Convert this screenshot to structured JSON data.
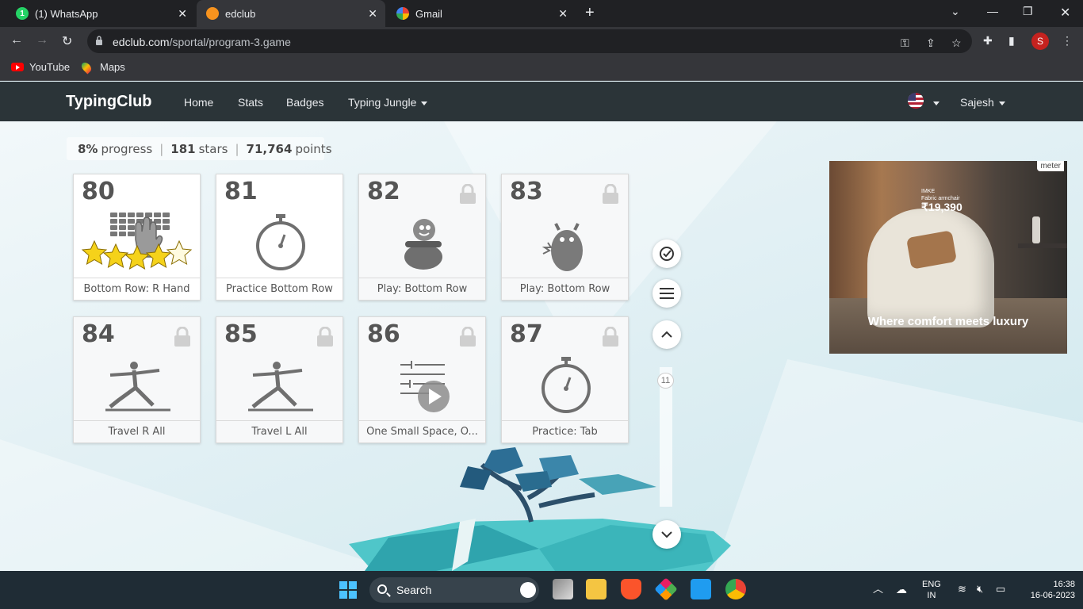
{
  "browser": {
    "tabs": [
      {
        "title": "(1) WhatsApp",
        "badge": "1"
      },
      {
        "title": "edclub"
      },
      {
        "title": "Gmail"
      }
    ],
    "url_domain": "edclub.com",
    "url_path": "/sportal/program-3.game",
    "profile_initial": "S",
    "bookmarks": [
      "YouTube",
      "Maps"
    ]
  },
  "site": {
    "logo": "TypingClub",
    "nav": [
      "Home",
      "Stats",
      "Badges",
      "Typing Jungle"
    ],
    "user": "Sajesh"
  },
  "stats": {
    "progress_value": "8%",
    "progress_label": "progress",
    "stars_value": "181",
    "stars_label": "stars",
    "points_value": "71,764",
    "points_label": "points"
  },
  "lessons": [
    {
      "number": "80",
      "title": "Bottom Row: R Hand",
      "icon": "keyboard-hand-icon",
      "locked": false,
      "stars": 5
    },
    {
      "number": "81",
      "title": "Practice Bottom Row",
      "icon": "stopwatch-icon",
      "locked": false
    },
    {
      "number": "82",
      "title": "Play: Bottom Row",
      "icon": "game-pot-icon",
      "locked": true
    },
    {
      "number": "83",
      "title": "Play: Bottom Row",
      "icon": "game-monster-icon",
      "locked": true
    },
    {
      "number": "84",
      "title": "Travel R All",
      "icon": "yoga-pose-icon",
      "locked": true
    },
    {
      "number": "85",
      "title": "Travel L All",
      "icon": "yoga-pose-icon",
      "locked": true
    },
    {
      "number": "86",
      "title": "One Small Space, O...",
      "icon": "tab-video-icon",
      "locked": true
    },
    {
      "number": "87",
      "title": "Practice: Tab",
      "icon": "stopwatch-icon",
      "locked": true
    }
  ],
  "scroll": {
    "indicator": "11"
  },
  "ad": {
    "brand": "meter",
    "product_name": "IMKE",
    "product_desc": "Fabric armchair",
    "price": "₹19,390",
    "tagline": "Where comfort meets luxury"
  },
  "taskbar": {
    "search_label": "Search",
    "language_top": "ENG",
    "language_bottom": "IN",
    "time": "16:38",
    "date": "16-06-2023"
  },
  "colors": {
    "accent_nav": "#2b3438",
    "star": "#f5d21a",
    "icon_gray": "#6f6f6f"
  }
}
